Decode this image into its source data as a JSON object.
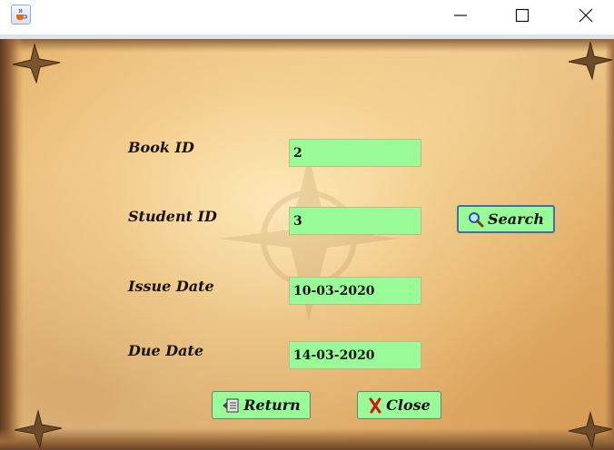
{
  "window": {
    "icons": {
      "app": "java-cup-icon",
      "minimize": "minimize-icon",
      "maximize": "maximize-icon",
      "close": "close-icon"
    }
  },
  "form": {
    "book_id": {
      "label": "Book ID",
      "value": "2"
    },
    "student_id": {
      "label": "Student ID",
      "value": "3"
    },
    "issue_date": {
      "label": "Issue Date",
      "value": "10-03-2020"
    },
    "due_date": {
      "label": "Due Date",
      "value": "14-03-2020"
    }
  },
  "buttons": {
    "search": {
      "label": "Search",
      "icon": "magnifier-icon"
    },
    "return": {
      "label": "Return",
      "icon": "book-icon"
    },
    "close": {
      "label": "Close",
      "icon": "red-x-icon"
    }
  },
  "colors": {
    "field_bg": "#98fb98",
    "button_bg": "#98fb98",
    "search_border": "#3f6fa6"
  }
}
